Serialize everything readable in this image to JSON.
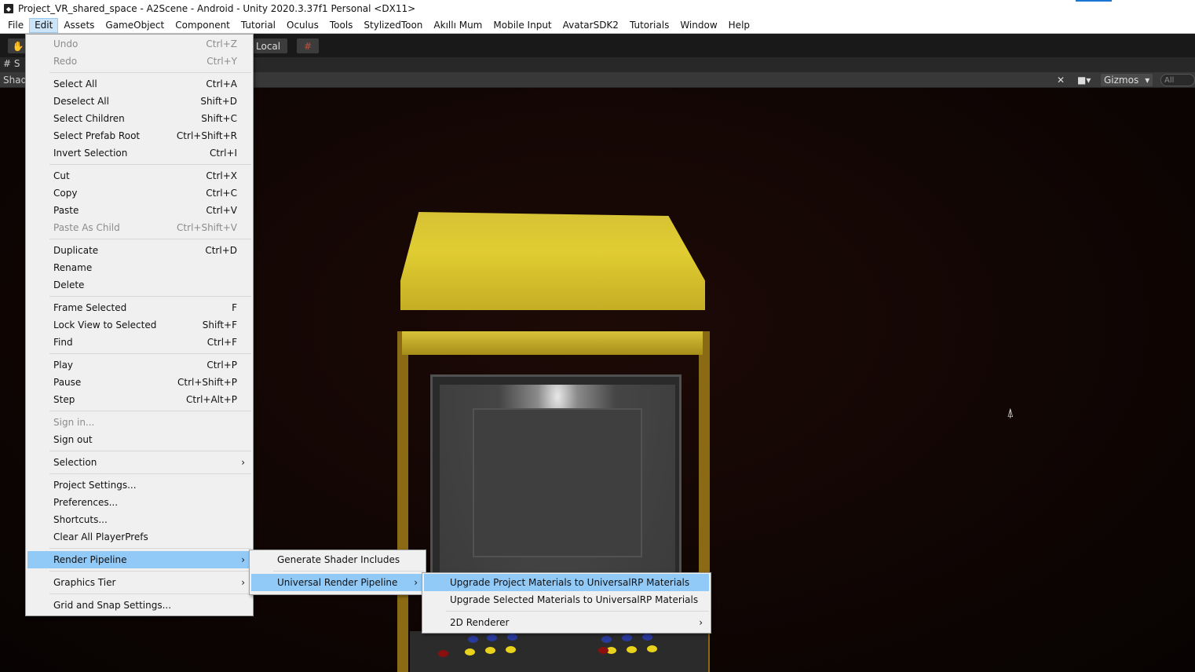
{
  "window": {
    "title": "Project_VR_shared_space - A2Scene - Android - Unity 2020.3.37f1 Personal <DX11>"
  },
  "menubar": {
    "items": [
      "File",
      "Edit",
      "Assets",
      "GameObject",
      "Component",
      "Tutorial",
      "Oculus",
      "Tools",
      "StylizedToon",
      "Akıllı Mum",
      "Mobile Input",
      "AvatarSDK2",
      "Tutorials",
      "Window",
      "Help"
    ],
    "active": "Edit"
  },
  "toolbar": {
    "local_label": "Local"
  },
  "scene": {
    "tab_label": "S",
    "shading_label": "Shad",
    "gizmos_label": "Gizmos",
    "search_placeholder": "All"
  },
  "edit_menu": {
    "undo": {
      "label": "Undo",
      "shortcut": "Ctrl+Z"
    },
    "redo": {
      "label": "Redo",
      "shortcut": "Ctrl+Y"
    },
    "select_all": {
      "label": "Select All",
      "shortcut": "Ctrl+A"
    },
    "deselect_all": {
      "label": "Deselect All",
      "shortcut": "Shift+D"
    },
    "select_children": {
      "label": "Select Children",
      "shortcut": "Shift+C"
    },
    "select_prefab_root": {
      "label": "Select Prefab Root",
      "shortcut": "Ctrl+Shift+R"
    },
    "invert_selection": {
      "label": "Invert Selection",
      "shortcut": "Ctrl+I"
    },
    "cut": {
      "label": "Cut",
      "shortcut": "Ctrl+X"
    },
    "copy": {
      "label": "Copy",
      "shortcut": "Ctrl+C"
    },
    "paste": {
      "label": "Paste",
      "shortcut": "Ctrl+V"
    },
    "paste_as_child": {
      "label": "Paste As Child",
      "shortcut": "Ctrl+Shift+V"
    },
    "duplicate": {
      "label": "Duplicate",
      "shortcut": "Ctrl+D"
    },
    "rename": {
      "label": "Rename"
    },
    "delete": {
      "label": "Delete"
    },
    "frame_selected": {
      "label": "Frame Selected",
      "shortcut": "F"
    },
    "lock_view": {
      "label": "Lock View to Selected",
      "shortcut": "Shift+F"
    },
    "find": {
      "label": "Find",
      "shortcut": "Ctrl+F"
    },
    "play": {
      "label": "Play",
      "shortcut": "Ctrl+P"
    },
    "pause": {
      "label": "Pause",
      "shortcut": "Ctrl+Shift+P"
    },
    "step": {
      "label": "Step",
      "shortcut": "Ctrl+Alt+P"
    },
    "sign_in": {
      "label": "Sign in..."
    },
    "sign_out": {
      "label": "Sign out"
    },
    "selection": {
      "label": "Selection"
    },
    "project_settings": {
      "label": "Project Settings..."
    },
    "preferences": {
      "label": "Preferences..."
    },
    "shortcuts": {
      "label": "Shortcuts..."
    },
    "clear_playerprefs": {
      "label": "Clear All PlayerPrefs"
    },
    "render_pipeline": {
      "label": "Render Pipeline"
    },
    "graphics_tier": {
      "label": "Graphics Tier"
    },
    "grid_snap": {
      "label": "Grid and Snap Settings..."
    }
  },
  "render_pipeline_menu": {
    "generate_shader_includes": "Generate Shader Includes",
    "universal_render_pipeline": "Universal Render Pipeline"
  },
  "urp_menu": {
    "upgrade_project": "Upgrade Project Materials to UniversalRP Materials",
    "upgrade_selected": "Upgrade Selected Materials to UniversalRP Materials",
    "renderer_2d": "2D Renderer"
  },
  "colors": {
    "menu_highlight": "#91c9f7",
    "menu_bg": "#f0f0f0",
    "cabinet_yellow": "#d6c234"
  }
}
